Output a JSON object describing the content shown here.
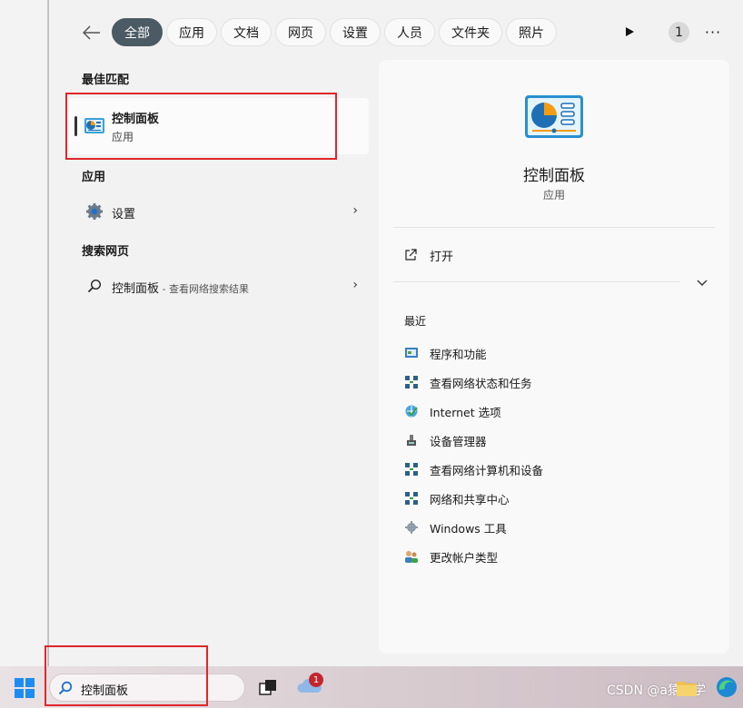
{
  "filters": {
    "tabs": [
      {
        "label": "全部",
        "active": true
      },
      {
        "label": "应用"
      },
      {
        "label": "文档"
      },
      {
        "label": "网页"
      },
      {
        "label": "设置"
      },
      {
        "label": "人员"
      },
      {
        "label": "文件夹"
      },
      {
        "label": "照片"
      }
    ],
    "count": "1",
    "more_label": "···"
  },
  "left": {
    "best_match_title": "最佳匹配",
    "best_match": {
      "name": "控制面板",
      "subtitle": "应用"
    },
    "apps_title": "应用",
    "apps": [
      {
        "label": "设置",
        "icon": "gear-icon"
      }
    ],
    "web_title": "搜索网页",
    "web": [
      {
        "label": "控制面板",
        "sub": " - 查看网络搜索结果",
        "icon": "search-icon"
      }
    ]
  },
  "detail": {
    "title": "控制面板",
    "subtitle": "应用",
    "open_label": "打开",
    "recent_title": "最近",
    "recent": [
      {
        "label": "程序和功能",
        "icon": "programs-icon"
      },
      {
        "label": "查看网络状态和任务",
        "icon": "network-icon"
      },
      {
        "label": "Internet 选项",
        "icon": "internet-icon"
      },
      {
        "label": "设备管理器",
        "icon": "device-manager-icon"
      },
      {
        "label": "查看网络计算机和设备",
        "icon": "network-icon"
      },
      {
        "label": "网络和共享中心",
        "icon": "network-icon"
      },
      {
        "label": "Windows 工具",
        "icon": "tools-icon"
      },
      {
        "label": "更改帐户类型",
        "icon": "users-icon"
      }
    ]
  },
  "taskbar": {
    "search_text": "控制面板",
    "weather_badge": "1",
    "watermark": "CSDN @a猿同学"
  },
  "colors": {
    "active_tab": "#4b5a63",
    "highlight_box": "#e0262b",
    "start_blue": "#1d8cf0",
    "badge_red": "#c4262e"
  }
}
